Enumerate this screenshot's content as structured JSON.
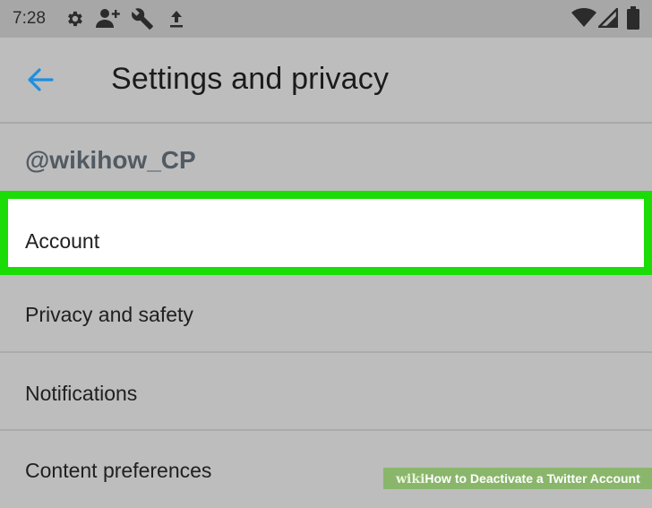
{
  "status_bar": {
    "time": "7:28",
    "icons": [
      "settings-gear-icon",
      "add-person-icon",
      "wrench-icon",
      "upload-icon",
      "wifi-icon",
      "signal-icon",
      "battery-icon"
    ]
  },
  "app_bar": {
    "title": "Settings and privacy",
    "back_icon": "arrow-left-icon",
    "accent_color": "#1da1f2"
  },
  "account": {
    "username": "@wikihow_CP"
  },
  "menu": {
    "items": [
      {
        "label": "Account",
        "highlighted": true
      },
      {
        "label": "Privacy and safety"
      },
      {
        "label": "Notifications"
      },
      {
        "label": "Content preferences"
      }
    ]
  },
  "highlight_color": "#1bdc07",
  "watermark": {
    "brand": "wiki",
    "text": "How to Deactivate a Twitter Account"
  }
}
